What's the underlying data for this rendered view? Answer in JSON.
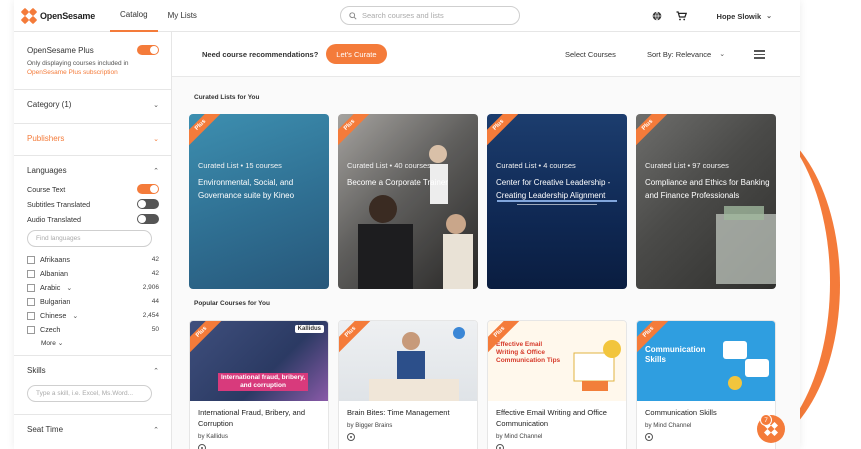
{
  "nav": {
    "brand": "OpenSesame",
    "tabs": [
      "Catalog",
      "My Lists"
    ],
    "search_placeholder": "Search courses and lists",
    "user_name": "Hope Slowik",
    "icons": [
      "globe-icon",
      "cart-icon"
    ]
  },
  "sidebar": {
    "plus_label": "OpenSesame Plus",
    "plus_note_prefix": "Only displaying courses included in",
    "plus_note_link": "OpenSesame Plus subscription",
    "category": "Category (1)",
    "publishers": "Publishers",
    "languages": "Languages",
    "toggles": [
      {
        "label": "Course Text",
        "on": true
      },
      {
        "label": "Subtitles Translated",
        "on": false
      },
      {
        "label": "Audio Translated",
        "on": false
      }
    ],
    "language_search_placeholder": "Find languages",
    "language_items": [
      {
        "name": "Afrikaans",
        "count": "42",
        "expandable": false
      },
      {
        "name": "Albanian",
        "count": "42",
        "expandable": false
      },
      {
        "name": "Arabic",
        "count": "2,906",
        "expandable": true
      },
      {
        "name": "Bulgarian",
        "count": "44",
        "expandable": false
      },
      {
        "name": "Chinese",
        "count": "2,454",
        "expandable": true
      },
      {
        "name": "Czech",
        "count": "50",
        "expandable": false
      }
    ],
    "more_label": "More",
    "skills": "Skills",
    "skills_placeholder": "Type a skill, i.e. Excel, Ms.Word...",
    "seat_time": "Seat Time"
  },
  "toolbar": {
    "reco_text": "Need course recommendations?",
    "curate_button": "Let's Curate",
    "select_courses": "Select Courses",
    "sort_label": "Sort By: Relevance"
  },
  "curated": {
    "section_title": "Curated Lists for You",
    "ribbon": "Plus",
    "cards": [
      {
        "sub": "Curated List • 15 courses",
        "title": "Environmental, Social, and Governance suite by Kineo"
      },
      {
        "sub": "Curated List • 40 courses",
        "title": "Become a Corporate Trainer"
      },
      {
        "sub": "Curated List • 4 courses",
        "title": "Center for Creative Leadership - Creating Leadership Alignment"
      },
      {
        "sub": "Curated List • 97 courses",
        "title": "Compliance and Ethics for Banking and Finance Professionals"
      }
    ]
  },
  "popular": {
    "section_title": "Popular Courses for You",
    "cards": [
      {
        "title": "International Fraud, Bribery, and Corruption",
        "by": "by Kallidus",
        "caption": "International fraud, bribery, and corruption",
        "logo": "Kallidus"
      },
      {
        "title": "Brain Bites: Time Management",
        "by": "by Bigger Brains",
        "caption": "",
        "logo": ""
      },
      {
        "title": "Effective Email Writing and Office Communication",
        "by": "by Mind Channel",
        "caption": "Effective Email Writing & Office Communication Tips",
        "logo": ""
      },
      {
        "title": "Communication Skills",
        "by": "by Mind Channel",
        "caption": "Communication Skills",
        "logo": ""
      }
    ]
  },
  "notification_count": "7",
  "colors": {
    "accent": "#f47b3a"
  }
}
